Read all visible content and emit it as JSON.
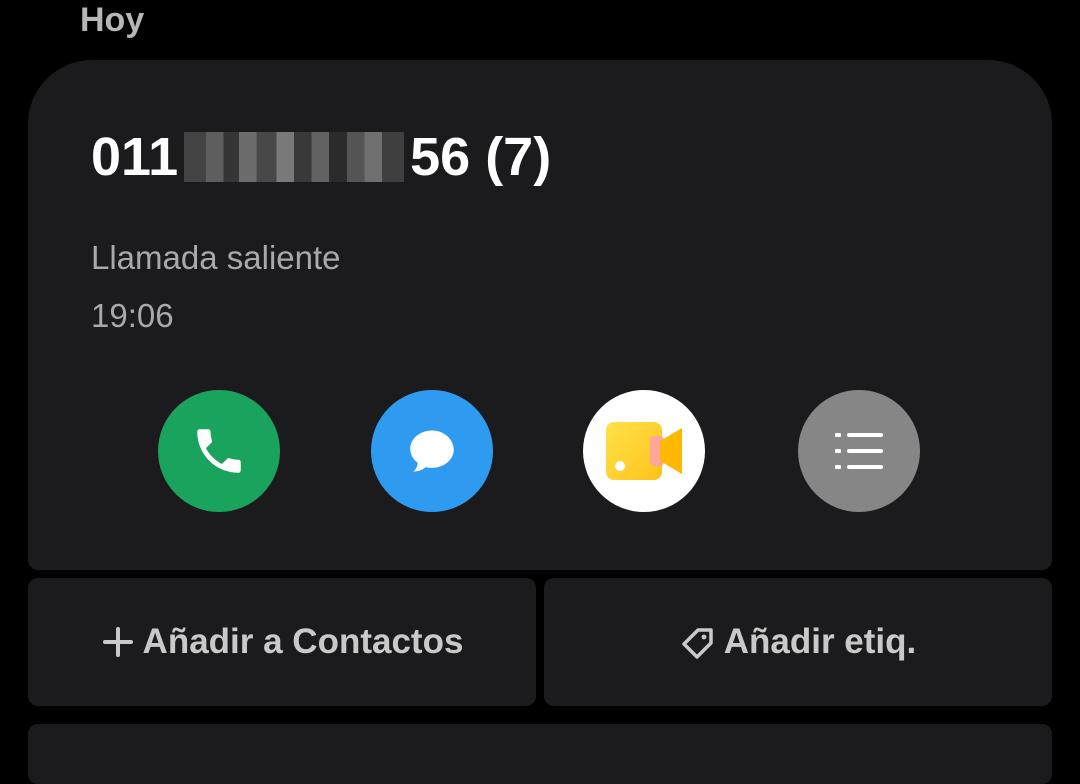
{
  "section": {
    "header": "Hoy"
  },
  "call_entry": {
    "number_prefix": "011",
    "number_suffix": "56 (7)",
    "call_type": "Llamada saliente",
    "time": "19:06"
  },
  "actions": [
    {
      "name": "call",
      "icon": "phone-icon",
      "color": "#1aa35c"
    },
    {
      "name": "message",
      "icon": "message-bubble-icon",
      "color": "#2f9bf0"
    },
    {
      "name": "video-call",
      "icon": "video-camera-icon",
      "color": "#ffffff"
    },
    {
      "name": "details",
      "icon": "list-icon",
      "color": "#868686"
    }
  ],
  "buttons": {
    "add_contact": "Añadir a Contactos",
    "add_tag": "Añadir etiq."
  }
}
